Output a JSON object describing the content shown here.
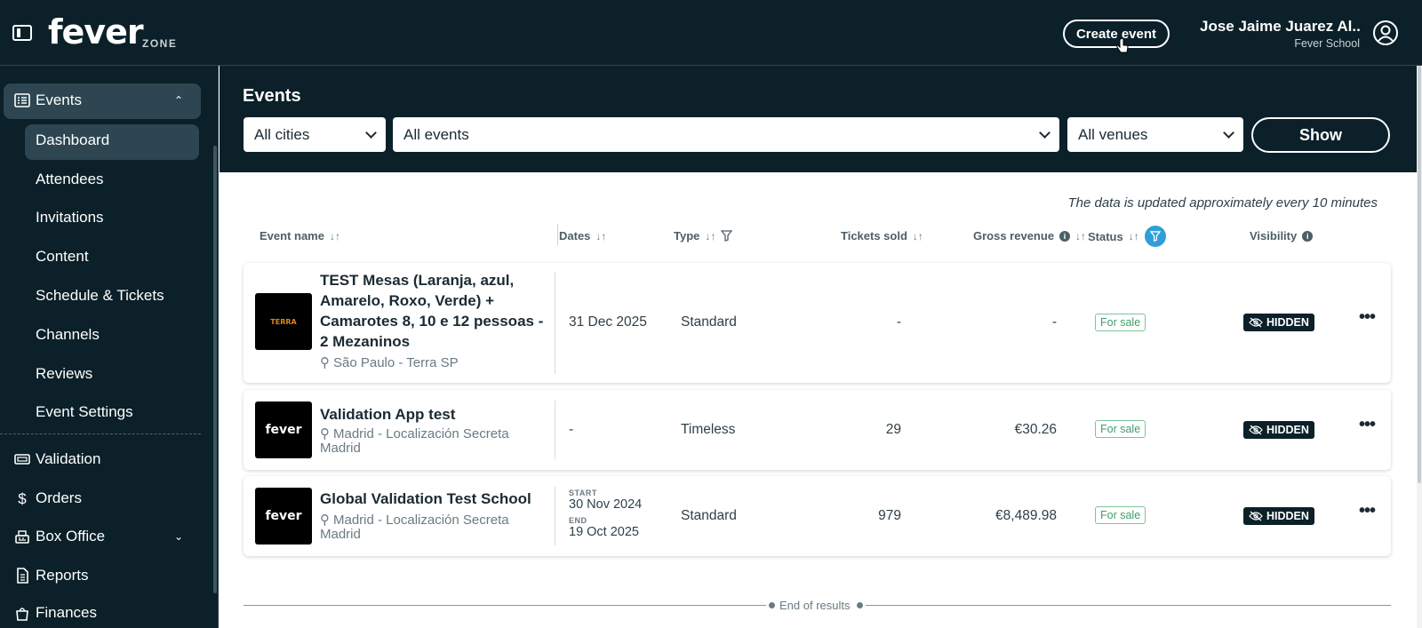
{
  "header": {
    "logo": "fever",
    "logo_sub": "ZONE",
    "create_event": "Create event",
    "user_name": "Jose Jaime Juarez Al...",
    "user_org": "Fever School"
  },
  "sidebar": {
    "events": "Events",
    "sub_items": [
      "Dashboard",
      "Attendees",
      "Invitations",
      "Content",
      "Schedule & Tickets",
      "Channels",
      "Reviews",
      "Event Settings"
    ],
    "items": [
      "Validation",
      "Orders",
      "Box Office",
      "Reports",
      "Finances"
    ]
  },
  "filters": {
    "title": "Events",
    "cities": "All cities",
    "events": "All events",
    "venues": "All venues",
    "show": "Show"
  },
  "table": {
    "note": "The data is updated approximately every 10 minutes",
    "headers": {
      "name": "Event name",
      "dates": "Dates",
      "type": "Type",
      "tickets": "Tickets sold",
      "revenue": "Gross revenue",
      "status": "Status",
      "visibility": "Visibility"
    },
    "rows": [
      {
        "thumb": "TERRA",
        "name": "TEST Mesas (Laranja, azul, Amarelo, Roxo, Verde) + Camarotes 8, 10 e 12 pessoas - 2 Mezaninos",
        "location": "São Paulo - Terra SP",
        "date": "31 Dec 2025",
        "type": "Standard",
        "tickets": "-",
        "revenue": "-",
        "status": "For sale",
        "visibility": "HIDDEN"
      },
      {
        "thumb": "fever",
        "name": "Validation App test",
        "location": "Madrid - Localización Secreta Madrid",
        "date": "-",
        "type": "Timeless",
        "tickets": "29",
        "revenue": "€30.26",
        "status": "For sale",
        "visibility": "HIDDEN"
      },
      {
        "thumb": "fever",
        "name": "Global Validation Test School",
        "location": "Madrid - Localización Secreta Madrid",
        "start_label": "START",
        "start": "30 Nov 2024",
        "end_label": "END",
        "end": "19 Oct 2025",
        "type": "Standard",
        "tickets": "979",
        "revenue": "€8,489.98",
        "status": "For sale",
        "visibility": "HIDDEN"
      }
    ],
    "end": "End of results"
  }
}
